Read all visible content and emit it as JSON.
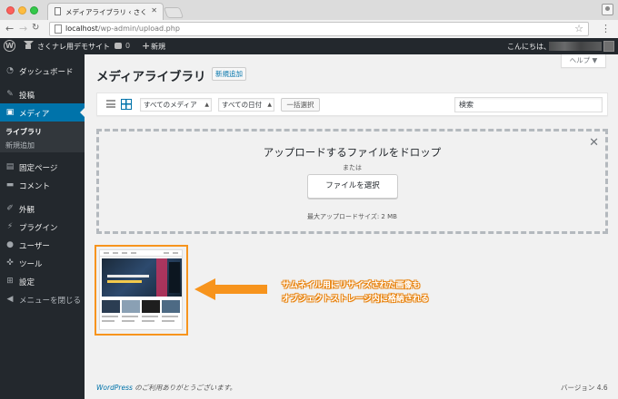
{
  "browser": {
    "tab_title": "メディアライブラリ ‹ さくナレ用デ",
    "url_host": "localhost",
    "url_path": "/wp-admin/upload.php"
  },
  "adminbar": {
    "site_name": "さくナレ用デモサイト",
    "comment_count": "0",
    "new_label": "新規",
    "howdy": "こんにちは、"
  },
  "sidebar": {
    "dashboard": "ダッシュボード",
    "posts": "投稿",
    "media": "メディア",
    "media_sub_library": "ライブラリ",
    "media_sub_add": "新規追加",
    "pages": "固定ページ",
    "comments": "コメント",
    "appearance": "外観",
    "plugins": "プラグイン",
    "users": "ユーザー",
    "tools": "ツール",
    "settings": "設定",
    "collapse": "メニューを閉じる"
  },
  "main": {
    "title": "メディアライブラリ",
    "add_new": "新規追加",
    "help": "ヘルプ ▼",
    "filter_type": "すべてのメディア",
    "filter_date": "すべての日付",
    "bulk_select": "一括選択",
    "search_placeholder": "検索"
  },
  "dropzone": {
    "title": "アップロードするファイルをドロップ",
    "or": "または",
    "select_button": "ファイルを選択",
    "max_size": "最大アップロードサイズ: 2 MB"
  },
  "annotation": {
    "line1": "サムネイル用にリサイズされた画像も",
    "line2": "オブジェクトストレージ内に格納される",
    "color": "#f7941d"
  },
  "footer": {
    "wp_link": "WordPress",
    "thanks": " のご利用ありがとうございます。",
    "version": "バージョン 4.6"
  },
  "colors": {
    "admin_bar": "#23282d",
    "active_menu": "#0073aa",
    "highlight": "#f7941d"
  }
}
